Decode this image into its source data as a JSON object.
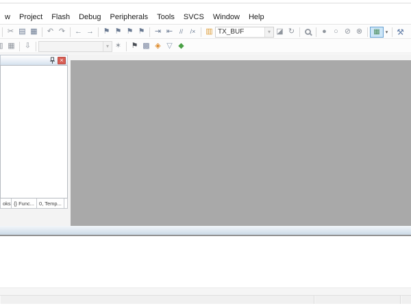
{
  "menu": {
    "items": [
      "w",
      "Project",
      "Flash",
      "Debug",
      "Peripherals",
      "Tools",
      "SVCS",
      "Window",
      "Help"
    ]
  },
  "toolbar_file": {
    "icons": {
      "cut": "✂",
      "copy": "▤",
      "paste": "▦",
      "undo": "↶",
      "redo": "↷",
      "nav_back": "←",
      "nav_forward": "→",
      "bookmark_toggle": "⚑",
      "bookmark_prev": "⚑",
      "bookmark_next": "⚑",
      "bookmark_clear": "⚑",
      "indent": "⇥",
      "outdent": "⇤",
      "comment": "//",
      "uncomment": "/×",
      "find_in_files": "▥",
      "find_next": "◪",
      "incremental_find": "↻",
      "breakpoint_toggle": "●",
      "breakpoint_enable": "○",
      "breakpoint_disable_all": "⊘",
      "breakpoint_kill_all": "⊗",
      "window_layout": "▦",
      "configuration": "⚒"
    },
    "find_combo": {
      "value": "TX_BUF"
    }
  },
  "toolbar_build": {
    "icons": {
      "edge_partial": "▥",
      "batch_build": "▦",
      "download": "⇩",
      "options_wand": "✶",
      "translate_flag": "⚑",
      "manage_items": "▩",
      "runtime_env": "◈",
      "filter_funnel": "▽",
      "pack_installer": "◆"
    },
    "target_combo": {
      "value": ""
    }
  },
  "glyphs": {
    "caret": "▾",
    "close": "×"
  },
  "project_panel": {
    "tabs": [
      {
        "label": "oks"
      },
      {
        "label": "{} Func..."
      },
      {
        "label": "0, Temp..."
      }
    ]
  },
  "status_bar": {
    "panes": [
      "",
      "",
      ""
    ]
  },
  "colors": {
    "editor_bg": "#a9a9a9",
    "close_red": "#d95f55",
    "caption_blue": "#d4e1ee",
    "highlight_blue": "#cde6f7"
  }
}
